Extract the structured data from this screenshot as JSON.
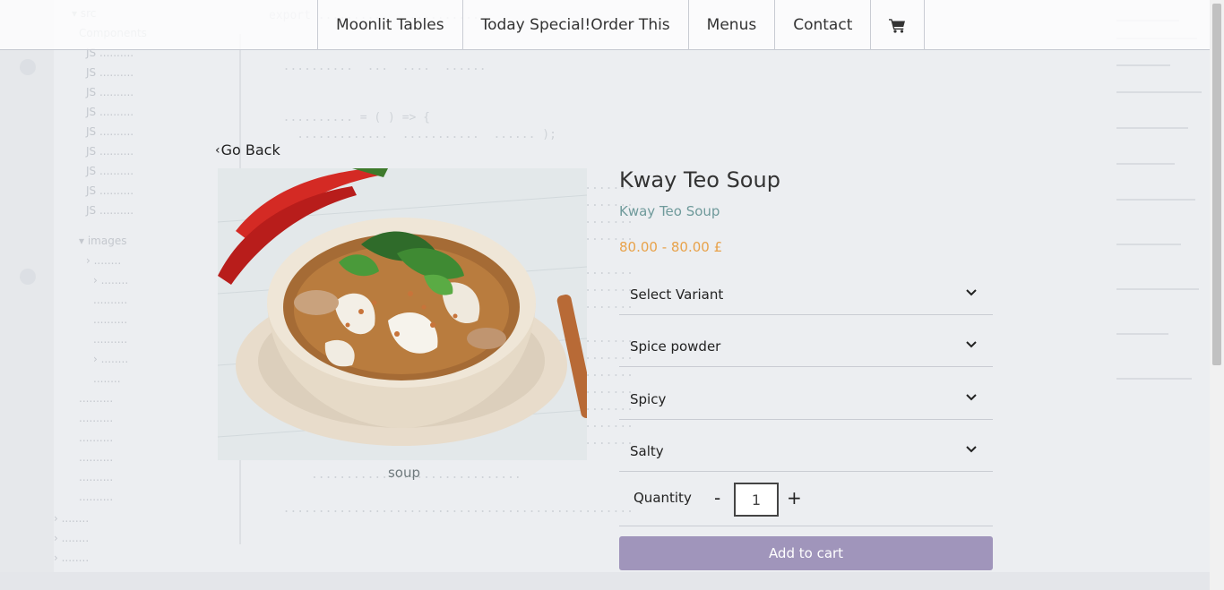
{
  "nav": {
    "items": [
      {
        "label": "Moonlit Tables"
      },
      {
        "label": "Today Special!Order This"
      },
      {
        "label": "Menus"
      },
      {
        "label": "Contact"
      }
    ],
    "cart_icon": "cart-icon"
  },
  "go_back": {
    "label": "Go Back",
    "icon": "chevron-left-icon"
  },
  "product": {
    "image_alt": "soup",
    "caption": "soup",
    "title": "Kway Teo Soup",
    "subtitle": "Kway Teo Soup",
    "price": "80.00 - 80.00 £"
  },
  "options": [
    {
      "label": "Select Variant"
    },
    {
      "label": "Spice powder"
    },
    {
      "label": "Spicy"
    },
    {
      "label": "Salty"
    }
  ],
  "quantity": {
    "label": "Quantity",
    "minus": "-",
    "value": "1",
    "plus": "+"
  },
  "add_to_cart": {
    "label": "Add to cart"
  },
  "colors": {
    "accent_button": "#a095bb",
    "price": "#e8a24a",
    "subtitle": "#6f9a9b"
  }
}
